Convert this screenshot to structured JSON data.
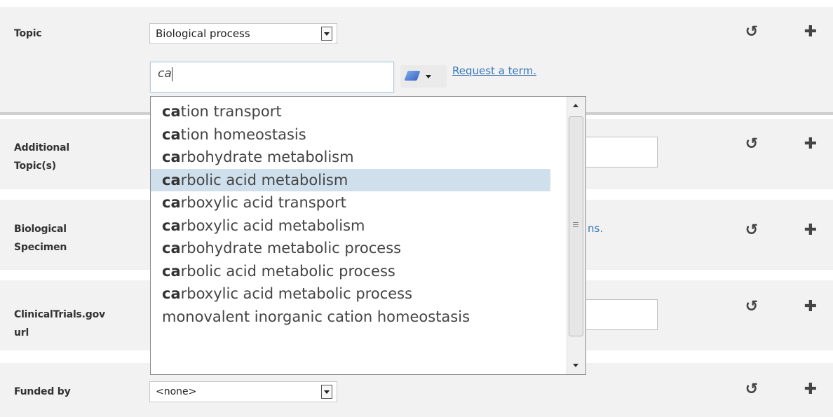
{
  "rows": {
    "topic": {
      "label": "Topic"
    },
    "additional_topics": {
      "label_line1": "Additional",
      "label_line2": "Topic(s)"
    },
    "biological_specimen": {
      "label_line1": "Biological",
      "label_line2": "Specimen",
      "partial_link": "ns."
    },
    "clinical_trials": {
      "label_line1": "ClinicalTrials.gov",
      "label_line2": "url"
    },
    "funded_by": {
      "label": "Funded by",
      "select_value": "<none>"
    }
  },
  "topic_select": {
    "value": "Biological process"
  },
  "search_input": {
    "value": "ca"
  },
  "request_term_link": "Request a term.",
  "suggestions": [
    {
      "match": "ca",
      "rest": "tion transport"
    },
    {
      "match": "ca",
      "rest": "tion homeostasis"
    },
    {
      "match": "ca",
      "rest": "rbohydrate metabolism"
    },
    {
      "match": "ca",
      "rest": "rbolic acid metabolism",
      "highlighted": true
    },
    {
      "match": "ca",
      "rest": "rboxylic acid transport"
    },
    {
      "match": "ca",
      "rest": "rboxylic acid metabolism"
    },
    {
      "match": "ca",
      "rest": "rbohydrate metabolic process"
    },
    {
      "match": "ca",
      "rest": "rbolic acid metabolic process"
    },
    {
      "match": "ca",
      "rest": "rboxylic acid metabolic process"
    },
    {
      "match": "",
      "rest": "monovalent inorganic cation homeostasis"
    }
  ],
  "icons": {
    "reset": "undo-icon",
    "add": "plus-icon",
    "vocabulary": "book-icon"
  },
  "colors": {
    "link": "#3b78b8",
    "highlight": "#cfe0ec",
    "band": "#f2f2f2"
  }
}
